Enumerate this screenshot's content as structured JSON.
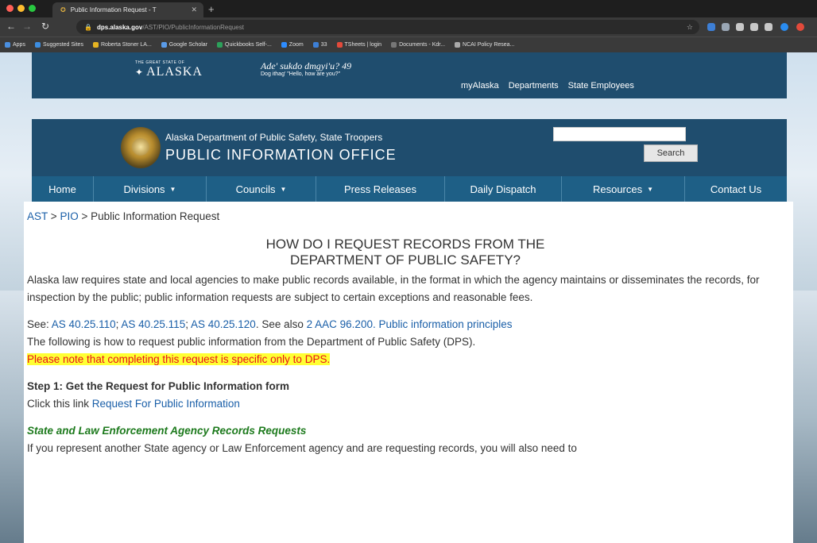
{
  "browser": {
    "tab_title": "Public Information Request - T",
    "url_domain": "dps.alaska.gov",
    "url_path": "/AST/PIO/PublicInformationRequest",
    "bookmarks": [
      "Apps",
      "Suggested Sites",
      "Roberta Stoner LA...",
      "Google Scholar",
      "Quickbooks Self-...",
      "Zoom",
      "33",
      "TSheets | login",
      "Documents - Kdr...",
      "NCAI Policy Resea..."
    ]
  },
  "state_header": {
    "logo_small": "THE GREAT STATE OF",
    "logo_big": "ALASKA",
    "tagline": "Ade' sukdo dmgyi'u? 49",
    "tagline_sub": "Dog ithag' \"Hello, how are you?\"",
    "links": [
      "myAlaska",
      "Departments",
      "State Employees"
    ]
  },
  "banner": {
    "dept": "Alaska Department of Public Safety, State Troopers",
    "office": "PUBLIC INFORMATION OFFICE",
    "search_label": "Search"
  },
  "nav": {
    "home": "Home",
    "divisions": "Divisions",
    "councils": "Councils",
    "press": "Press Releases",
    "dispatch": "Daily Dispatch",
    "resources": "Resources",
    "contact": "Contact Us"
  },
  "breadcrumb": {
    "ast": "AST",
    "sep": ">",
    "pio": "PIO",
    "current": "Public Information Request"
  },
  "content": {
    "title_line1": "HOW DO I REQUEST RECORDS FROM THE",
    "title_line2": "DEPARTMENT OF PUBLIC SAFETY?",
    "intro": "Alaska law requires state and local agencies to make public records available, in the format in which the agency maintains or disseminates the records, for inspection by the public; public information requests are subject to certain exceptions and reasonable fees.",
    "see_prefix": "See:",
    "law1": "AS 40.25.110",
    "law2": "AS 40.25.115",
    "law3": "AS 40.25.120",
    "see_also": "See also",
    "law4": "2 AAC 96.200. Public information principles",
    "howto": "The following is how to request public information from the Department of Public Safety (DPS).",
    "note": "Please note that completing this request is specific only to DPS.",
    "step1_title": "Step 1: Get the Request for Public Information form",
    "step1_prefix": "Click this link",
    "step1_link": "Request For Public Information",
    "agency_heading": "State and Law Enforcement Agency Records Requests",
    "agency_text": "If you represent another State agency or Law Enforcement agency and are requesting records, you will also need to"
  }
}
